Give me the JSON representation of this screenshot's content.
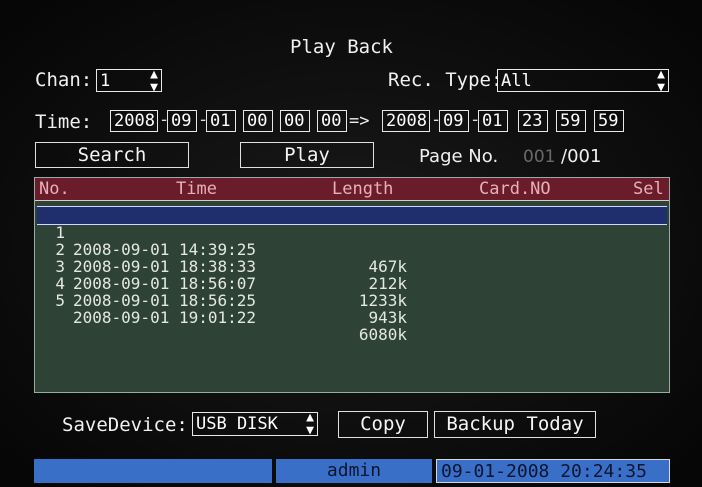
{
  "title": "Play Back",
  "chan": {
    "label": "Chan:",
    "value": "1"
  },
  "rec_type": {
    "label": "Rec. Type:",
    "value": "All"
  },
  "time": {
    "label": "Time:",
    "start": {
      "year": "2008",
      "month": "09",
      "day": "01",
      "hour": "00",
      "min": "00",
      "sec": "00"
    },
    "arrow": "=>",
    "end": {
      "year": "2008",
      "month": "09",
      "day": "01",
      "hour": "23",
      "min": "59",
      "sec": "59"
    }
  },
  "buttons": {
    "search": "Search",
    "play": "Play"
  },
  "page": {
    "label": "Page No.",
    "current": "001",
    "total": "/001"
  },
  "table": {
    "headers": {
      "no": "No.",
      "time": "Time",
      "length": "Length",
      "card": "Card.NO",
      "sel": "Sel"
    },
    "rows": [
      {
        "no": "1",
        "time": "2008-09-01 14:39:25",
        "length": "467k"
      },
      {
        "no": "2",
        "time": "2008-09-01 18:38:33",
        "length": "212k"
      },
      {
        "no": "3",
        "time": "2008-09-01 18:56:07",
        "length": "1233k"
      },
      {
        "no": "4",
        "time": "2008-09-01 18:56:25",
        "length": "943k"
      },
      {
        "no": "5",
        "time": "2008-09-01 19:01:22",
        "length": "6080k"
      }
    ]
  },
  "save_device": {
    "label": "SaveDevice:",
    "value": "USB DISK"
  },
  "copy_label": "Copy",
  "backup_label": "Backup Today",
  "status": {
    "user": "admin",
    "datetime": "09-01-2008 20:24:35"
  },
  "colors": {
    "header_bg": "#6a1c2a",
    "table_bg": "#2e4236",
    "selected_row": "#1f2f6e",
    "status_bar": "#3a6fc8"
  }
}
